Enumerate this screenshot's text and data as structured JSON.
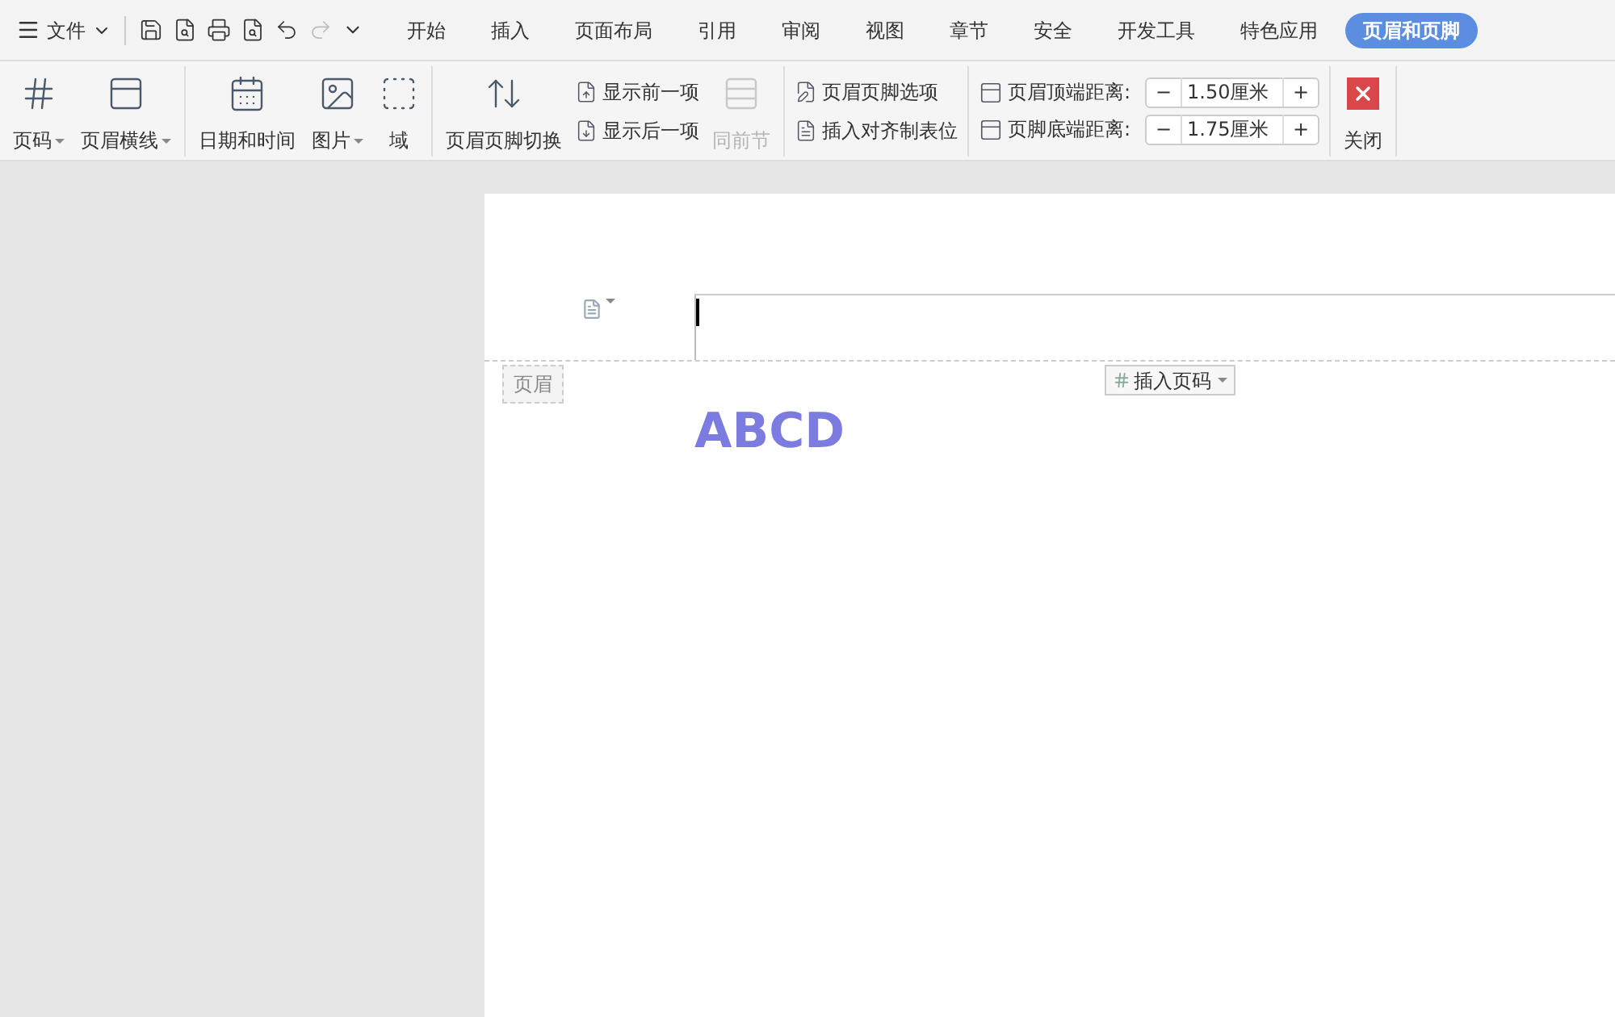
{
  "menu": {
    "label": "文件"
  },
  "tabs": [
    {
      "label": "开始",
      "selected": false
    },
    {
      "label": "插入",
      "selected": false
    },
    {
      "label": "页面布局",
      "selected": false
    },
    {
      "label": "引用",
      "selected": false
    },
    {
      "label": "审阅",
      "selected": false
    },
    {
      "label": "视图",
      "selected": false
    },
    {
      "label": "章节",
      "selected": false
    },
    {
      "label": "安全",
      "selected": false
    },
    {
      "label": "开发工具",
      "selected": false
    },
    {
      "label": "特色应用",
      "selected": false
    },
    {
      "label": "页眉和页脚",
      "selected": true
    }
  ],
  "ribbon": {
    "groups": [
      {
        "items": [
          {
            "kind": "large",
            "label": "页码",
            "dropdown": true,
            "disabled": false
          },
          {
            "kind": "large",
            "label": "页眉横线",
            "dropdown": true,
            "disabled": false
          }
        ]
      },
      {
        "items": [
          {
            "kind": "large",
            "label": "日期和时间",
            "dropdown": false,
            "disabled": false
          },
          {
            "kind": "large",
            "label": "图片",
            "dropdown": true,
            "disabled": false
          },
          {
            "kind": "large",
            "label": "域",
            "dropdown": false,
            "disabled": false
          }
        ]
      },
      {
        "items": [
          {
            "kind": "large",
            "label": "页眉页脚切换",
            "dropdown": false,
            "disabled": false
          },
          {
            "kind": "stack",
            "items": [
              {
                "label": "显示前一项",
                "disabled": false
              },
              {
                "label": "显示后一项",
                "disabled": false
              }
            ]
          },
          {
            "kind": "large",
            "label": "同前节",
            "dropdown": false,
            "disabled": true
          }
        ]
      },
      {
        "items": [
          {
            "kind": "stack",
            "items": [
              {
                "label": "页眉页脚选项",
                "disabled": false
              },
              {
                "label": "插入对齐制表位",
                "disabled": false
              }
            ]
          }
        ]
      },
      {
        "items": [
          {
            "kind": "spinners",
            "items": [
              {
                "label": "页眉顶端距离:",
                "value": "1.50厘米",
                "minus": "−",
                "plus": "+"
              },
              {
                "label": "页脚底端距离:",
                "value": "1.75厘米",
                "minus": "−",
                "plus": "+"
              }
            ]
          }
        ]
      },
      {
        "items": [
          {
            "kind": "large",
            "label": "关闭",
            "dropdown": false,
            "disabled": false
          }
        ]
      }
    ]
  },
  "document": {
    "header_tag": "页眉",
    "insert_page_number": "插入页码",
    "body_text": "ABCD"
  }
}
